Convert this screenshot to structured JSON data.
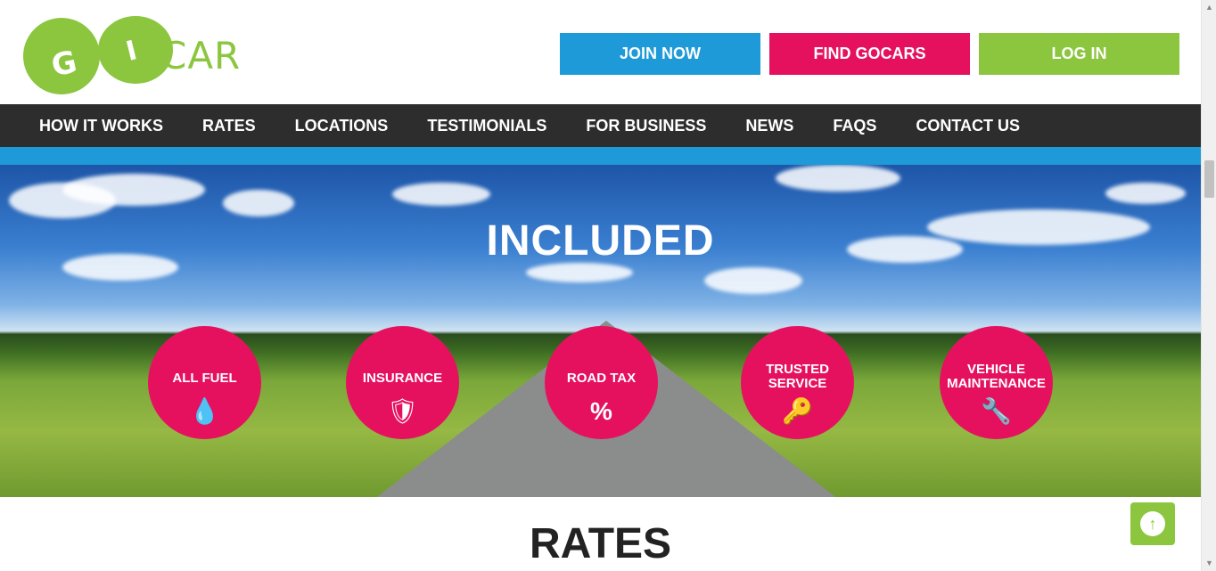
{
  "logo": {
    "letter_g": "G",
    "letter_i": "I",
    "word": "CAR"
  },
  "header_buttons": {
    "join": "JOIN NOW",
    "find": "FIND GOCARS",
    "login": "LOG IN"
  },
  "nav": [
    "HOW IT WORKS",
    "RATES",
    "LOCATIONS",
    "TESTIMONIALS",
    "FOR BUSINESS",
    "NEWS",
    "FAQS",
    "CONTACT US"
  ],
  "hero": {
    "title": "INCLUDED",
    "features": [
      {
        "label": "ALL FUEL",
        "icon": "drop-icon",
        "glyph": "💧"
      },
      {
        "label": "INSURANCE",
        "icon": "shield-icon",
        "glyph": "🛡"
      },
      {
        "label": "ROAD TAX",
        "icon": "percent-icon",
        "glyph": "%"
      },
      {
        "label_line1": "TRUSTED",
        "label_line2": "SERVICE",
        "icon": "key-icon",
        "glyph": "🔑"
      },
      {
        "label_line1": "VEHICLE",
        "label_line2": "MAINTENANCE",
        "icon": "wrench-icon",
        "glyph": "🔧"
      }
    ]
  },
  "rates": {
    "title": "RATES"
  },
  "back_to_top": {
    "icon": "arrow-up-circle-icon",
    "glyph": "↑"
  },
  "colors": {
    "green": "#8cc63f",
    "blue": "#1e9ad8",
    "pink": "#e5115f",
    "nav_bg": "#2d2d2d"
  }
}
